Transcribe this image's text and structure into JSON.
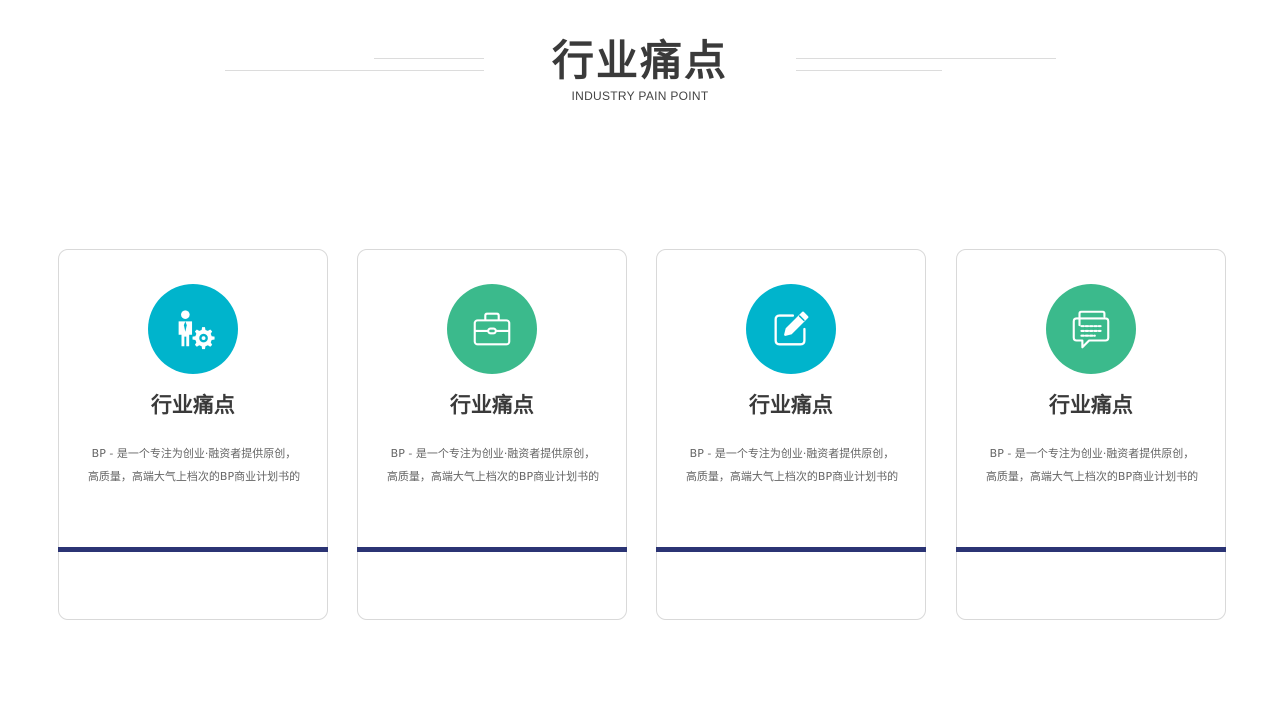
{
  "header": {
    "title": "行业痛点",
    "subtitle": "INDUSTRY PAIN POINT"
  },
  "colors": {
    "teal": "#00b4cc",
    "green": "#3bba8c",
    "accent_bar": "#2b3474",
    "title_text": "#3a3a3a"
  },
  "cards": [
    {
      "icon": "businessman-gear-icon",
      "icon_color": "#00b4cc",
      "title": "行业痛点",
      "desc_line1": "BP - 是一个专注为创业·融资者提供原创，",
      "desc_line2": "高质量，高端大气上档次的BP商业计划书的"
    },
    {
      "icon": "briefcase-icon",
      "icon_color": "#3bba8c",
      "title": "行业痛点",
      "desc_line1": "BP - 是一个专注为创业·融资者提供原创，",
      "desc_line2": "高质量，高端大气上档次的BP商业计划书的"
    },
    {
      "icon": "edit-pencil-icon",
      "icon_color": "#00b4cc",
      "title": "行业痛点",
      "desc_line1": "BP - 是一个专注为创业·融资者提供原创，",
      "desc_line2": "高质量，高端大气上档次的BP商业计划书的"
    },
    {
      "icon": "chat-bubbles-icon",
      "icon_color": "#3bba8c",
      "title": "行业痛点",
      "desc_line1": "BP - 是一个专注为创业·融资者提供原创，",
      "desc_line2": "高质量，高端大气上档次的BP商业计划书的"
    }
  ]
}
